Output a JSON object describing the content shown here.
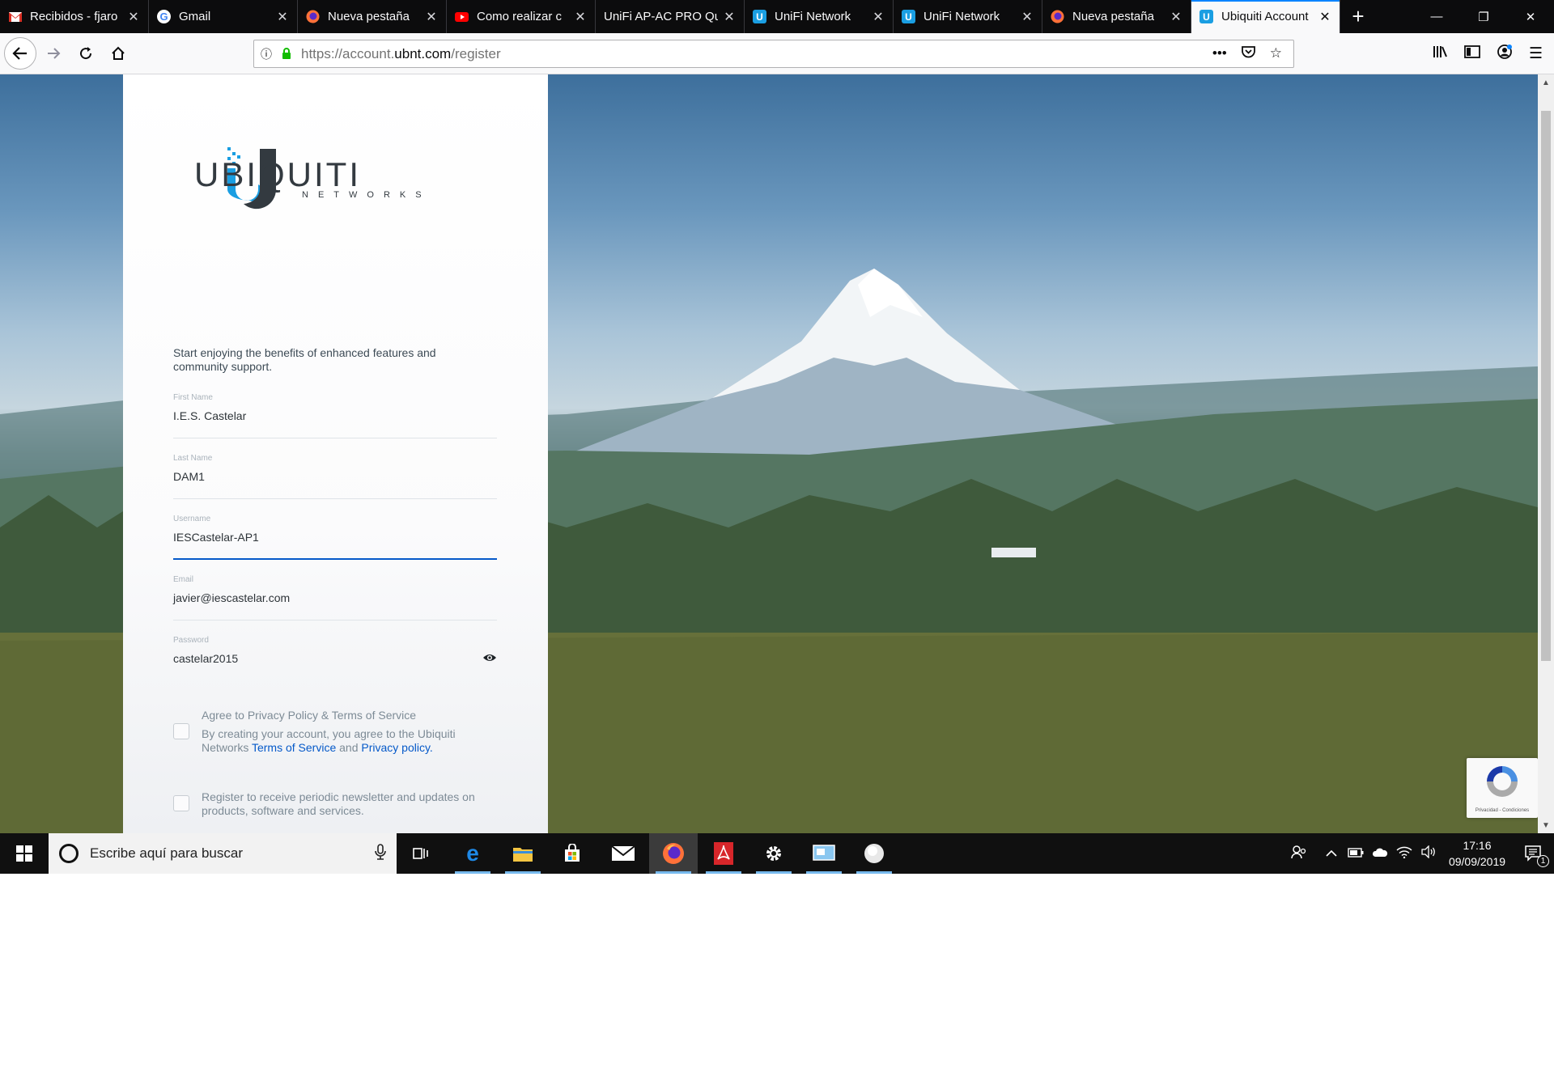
{
  "browser": {
    "tabs": [
      {
        "title": "Recibidos - fjaro",
        "favicon": "gmail-icon",
        "active": false
      },
      {
        "title": "Gmail",
        "favicon": "google-icon",
        "active": false
      },
      {
        "title": "Nueva pestaña",
        "favicon": "firefox-icon",
        "active": false
      },
      {
        "title": "Como realizar c",
        "favicon": "youtube-icon",
        "active": false
      },
      {
        "title": "UniFi AP-AC PRO Qu",
        "favicon": "",
        "active": false
      },
      {
        "title": "UniFi Network",
        "favicon": "ubiquiti-icon",
        "active": false
      },
      {
        "title": "UniFi Network",
        "favicon": "ubiquiti-icon",
        "active": false
      },
      {
        "title": "Nueva pestaña",
        "favicon": "firefox-icon",
        "active": false
      },
      {
        "title": "Ubiquiti Account",
        "favicon": "ubiquiti-icon",
        "active": true
      }
    ],
    "url": {
      "prefix": "https://account.",
      "domain": "ubnt.com",
      "path": "/register"
    }
  },
  "page": {
    "logo": {
      "word": "UBIQUITI",
      "sub": "NETWORKS"
    },
    "intro": "Start enjoying the benefits of enhanced features and community support.",
    "fields": {
      "first_name": {
        "label": "First Name",
        "value": "I.E.S. Castelar"
      },
      "last_name": {
        "label": "Last Name",
        "value": "DAM1"
      },
      "username": {
        "label": "Username",
        "value": "IESCastelar-AP1"
      },
      "email": {
        "label": "Email",
        "value": "javier@iescastelar.com"
      },
      "password": {
        "label": "Password",
        "value": "castelar2015"
      }
    },
    "agree": {
      "title": "Agree to Privacy Policy & Terms of Service",
      "text_before": "By creating your account, you agree to the Ubiquiti Networks ",
      "terms_link": "Terms of Service",
      "text_and": " and ",
      "privacy_link": "Privacy policy",
      "text_after": "."
    },
    "newsletter": "Register to receive periodic newsletter and updates on products, software and services.",
    "recaptcha_text": "Privacidad - Condiciones"
  },
  "taskbar": {
    "search_placeholder": "Escribe aquí para buscar",
    "time": "17:16",
    "date": "09/09/2019",
    "notification_count": "1"
  },
  "colors": {
    "accent": "#0a84ff",
    "link": "#0559c9",
    "ubiquiti_blue": "#1a9ee2"
  }
}
